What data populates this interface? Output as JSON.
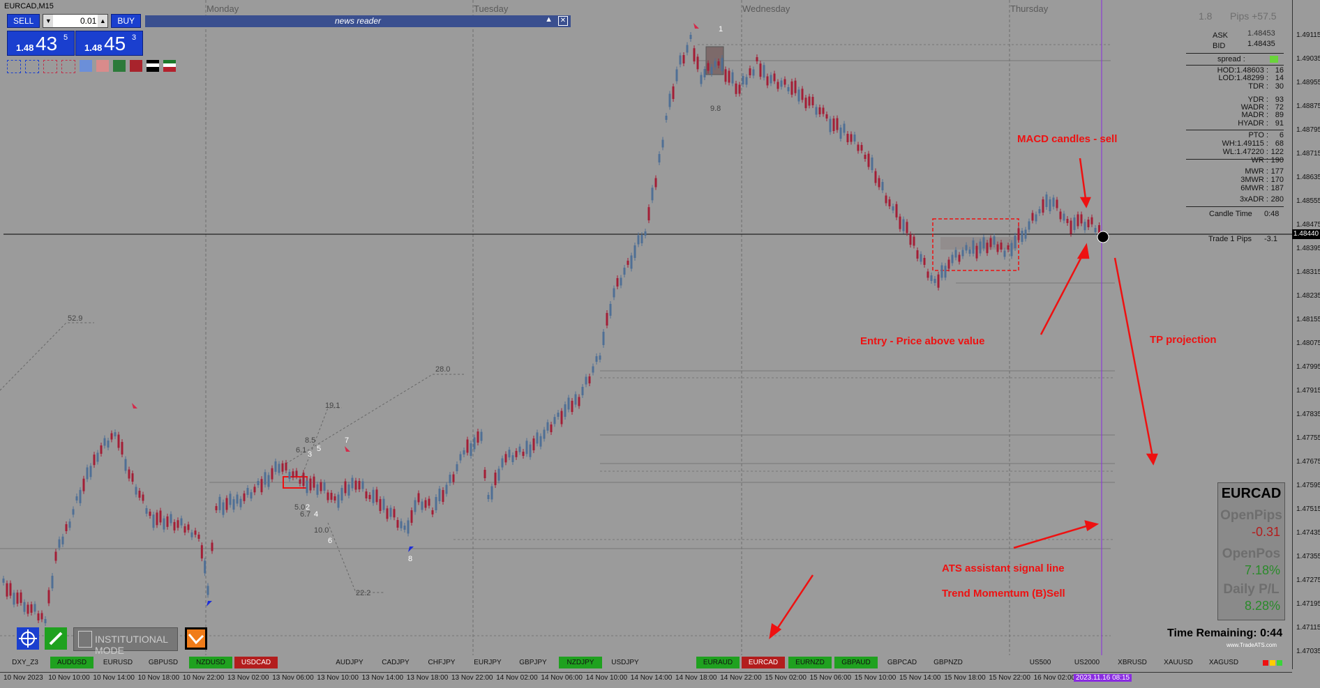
{
  "window": {
    "title": "EURCAD,M15"
  },
  "trade_panel": {
    "sell_label": "SELL",
    "buy_label": "BUY",
    "lot_value": "0.01",
    "bid": {
      "prefix": "1.48",
      "big": "43",
      "sup": "5"
    },
    "ask": {
      "prefix": "1.48",
      "big": "45",
      "sup": "3"
    }
  },
  "news_reader": {
    "title": "news reader"
  },
  "days": [
    "Monday",
    "Tuesday",
    "Wednesday",
    "Thursday"
  ],
  "info_panel": {
    "header_left": "1.8",
    "header_right": "Pips +57.5",
    "ask_label": "ASK",
    "ask_value": "1.48453",
    "bid_label": "BID",
    "bid_value": "1.48435",
    "spread_label": "spread :",
    "rows": [
      {
        "label": "HOD:1.48603 :",
        "value": "16"
      },
      {
        "label": "LOD:1.48299 :",
        "value": "14"
      },
      {
        "label": "TDR :",
        "value": "30"
      },
      {
        "label": "YDR :",
        "value": "93"
      },
      {
        "label": "WADR :",
        "value": "72"
      },
      {
        "label": "MADR :",
        "value": "89"
      },
      {
        "label": "HYADR :",
        "value": "91"
      },
      {
        "label": "PTO :",
        "value": "6"
      },
      {
        "label": "WH:1.49115 :",
        "value": "68"
      },
      {
        "label": "WL:1.47220 :",
        "value": "122"
      },
      {
        "label": "WR :",
        "value": "190"
      },
      {
        "label": "MWR :",
        "value": "177"
      },
      {
        "label": "3MWR :",
        "value": "170"
      },
      {
        "label": "6MWR :",
        "value": "187"
      },
      {
        "label": "3xADR :",
        "value": "280"
      }
    ],
    "candle_time_label": "Candle Time",
    "candle_time_value": "0:48",
    "trade_label": "Trade 1 Pips",
    "trade_value": "-3.1"
  },
  "y_axis": {
    "ticks": [
      "1.49115",
      "1.49035",
      "1.48955",
      "1.48875",
      "1.48795",
      "1.48715",
      "1.48635",
      "1.48555",
      "1.48475",
      "1.48395",
      "1.48315",
      "1.48235",
      "1.48155",
      "1.48075",
      "1.47995",
      "1.47915",
      "1.47835",
      "1.47755",
      "1.47675",
      "1.47595",
      "1.47515",
      "1.47435",
      "1.47355",
      "1.47275",
      "1.47195",
      "1.47115",
      "1.47035"
    ],
    "current_price": "1.48440"
  },
  "x_axis": {
    "ticks": [
      "10 Nov 2023",
      "10 Nov 10:00",
      "10 Nov 14:00",
      "10 Nov 18:00",
      "10 Nov 22:00",
      "13 Nov 02:00",
      "13 Nov 06:00",
      "13 Nov 10:00",
      "13 Nov 14:00",
      "13 Nov 18:00",
      "13 Nov 22:00",
      "14 Nov 02:00",
      "14 Nov 06:00",
      "14 Nov 10:00",
      "14 Nov 14:00",
      "14 Nov 18:00",
      "14 Nov 22:00",
      "15 Nov 02:00",
      "15 Nov 06:00",
      "15 Nov 10:00",
      "15 Nov 14:00",
      "15 Nov 18:00",
      "15 Nov 22:00",
      "16 Nov 02:00"
    ],
    "highlight": "2023.11.16 08:15"
  },
  "symbols": [
    {
      "name": "DXY_Z3",
      "color": "none"
    },
    {
      "name": "AUDUSD",
      "color": "green"
    },
    {
      "name": "EURUSD",
      "color": "none"
    },
    {
      "name": "GBPUSD",
      "color": "none"
    },
    {
      "name": "NZDUSD",
      "color": "green"
    },
    {
      "name": "USDCAD",
      "color": "red"
    },
    {
      "name": "AUDJPY",
      "color": "none"
    },
    {
      "name": "CADJPY",
      "color": "none"
    },
    {
      "name": "CHFJPY",
      "color": "none"
    },
    {
      "name": "EURJPY",
      "color": "none"
    },
    {
      "name": "GBPJPY",
      "color": "none"
    },
    {
      "name": "NZDJPY",
      "color": "green"
    },
    {
      "name": "USDJPY",
      "color": "none"
    },
    {
      "name": "EURAUD",
      "color": "green"
    },
    {
      "name": "EURCAD",
      "color": "red"
    },
    {
      "name": "EURNZD",
      "color": "green"
    },
    {
      "name": "GBPAUD",
      "color": "green"
    },
    {
      "name": "GBPCAD",
      "color": "none"
    },
    {
      "name": "GBPNZD",
      "color": "none"
    },
    {
      "name": "US500",
      "color": "none"
    },
    {
      "name": "US2000",
      "color": "none"
    },
    {
      "name": "XBRUSD",
      "color": "none"
    },
    {
      "name": "XAUUSD",
      "color": "none"
    },
    {
      "name": "XAGUSD",
      "color": "none"
    }
  ],
  "annotations": {
    "macd": "MACD candles - sell",
    "entry": "Entry - Price above value",
    "tp": "TP projection",
    "ats": "ATS assistant signal line",
    "trend": "Trend Momentum (B)Sell"
  },
  "fib_labels": [
    "52.9",
    "28.0",
    "19.1",
    "8.5",
    "6.1",
    "5",
    "5.0",
    "6.7",
    "10.0",
    "22.2",
    "9.8",
    "1",
    "7",
    "8",
    "2",
    "4",
    "6",
    "3"
  ],
  "stats": {
    "symbol": "EURCAD",
    "open_pips_label": "OpenPips",
    "open_pips_value": "-0.31",
    "open_pos_label": "OpenPos",
    "open_pos_value": "7.18%",
    "daily_pl_label": "Daily P/L",
    "daily_pl_value": "8.28%"
  },
  "time_remaining": {
    "label": "Time Remaining:",
    "value": "0:44"
  },
  "watermark": "www.TradeATS.com",
  "tools": {
    "institutional_mode": "INSTITUTIONAL MODE"
  },
  "colors": {
    "bull": "#4f6f95",
    "bear": "#a31e36",
    "background": "#9b9b9b",
    "annotation": "#e11111",
    "vline": "#8a2be2"
  }
}
